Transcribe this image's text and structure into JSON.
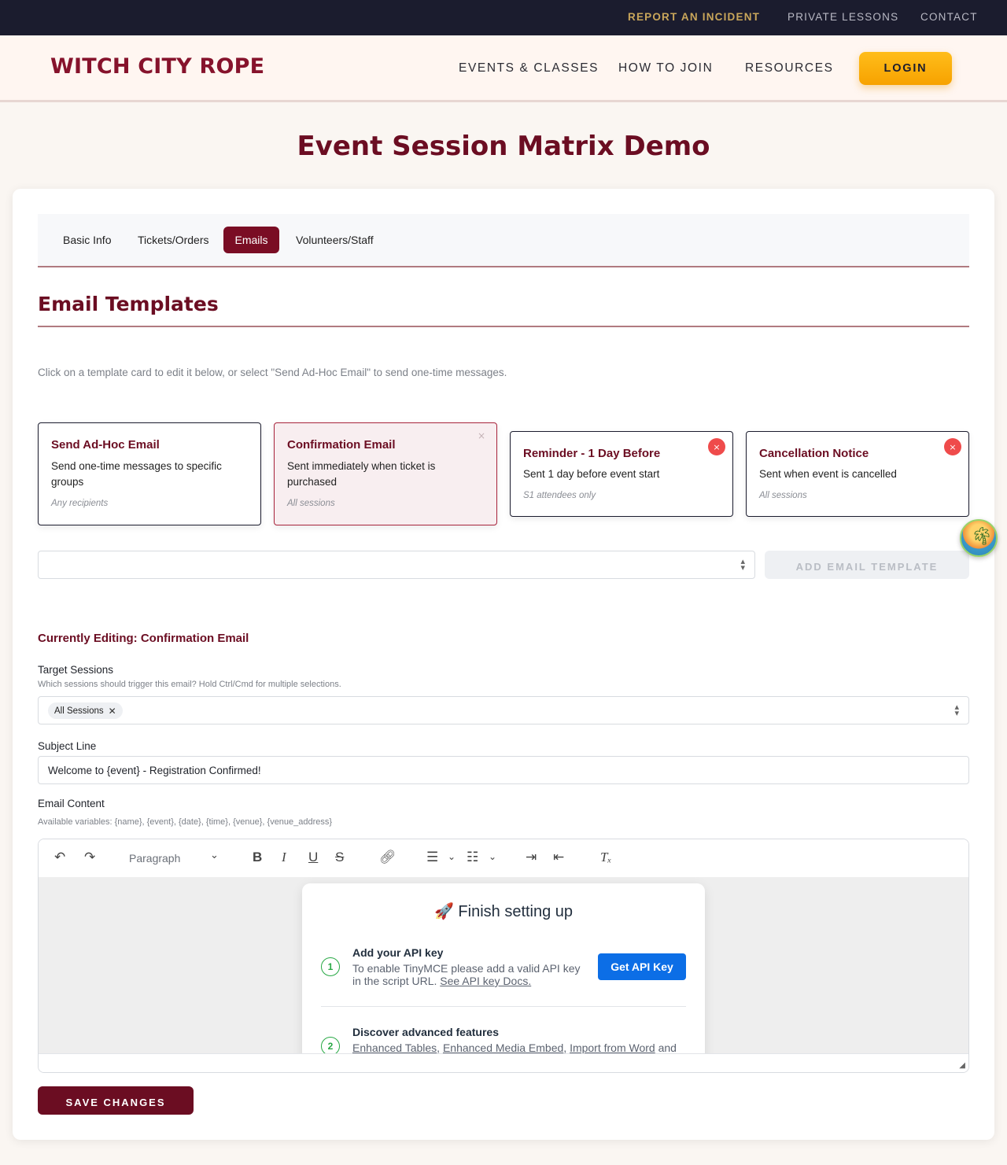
{
  "utility_nav": {
    "report": "REPORT AN INCIDENT",
    "lessons": "PRIVATE LESSONS",
    "contact": "CONTACT"
  },
  "header": {
    "logo": "WITCH CITY ROPE",
    "nav": {
      "events": "EVENTS & CLASSES",
      "join": "HOW TO JOIN",
      "resources": "RESOURCES"
    },
    "login": "LOGIN"
  },
  "page": {
    "title": "Event Session Matrix Demo"
  },
  "tabs": {
    "basic": "Basic Info",
    "tickets": "Tickets/Orders",
    "emails": "Emails",
    "volunteers": "Volunteers/Staff",
    "active": "Emails"
  },
  "email_templates": {
    "title": "Email Templates",
    "help": "Click on a template card to edit it below, or select \"Send Ad-Hoc Email\" to send one-time messages.",
    "cards": [
      {
        "title": "Send Ad-Hoc Email",
        "description": "Send one-time messages to specific groups",
        "meta": "Any recipients"
      },
      {
        "title": "Confirmation Email",
        "description": "Sent immediately when ticket is purchased",
        "meta": "All sessions",
        "close": "×"
      },
      {
        "title": "Reminder - 1 Day Before",
        "description": "Sent 1 day before event start",
        "meta": "S1 attendees only",
        "delete": "×"
      },
      {
        "title": "Cancellation Notice",
        "description": "Sent when event is cancelled",
        "meta": "All sessions",
        "delete": "×"
      }
    ],
    "template_select_value": "",
    "add_button": "ADD EMAIL TEMPLATE"
  },
  "editing": {
    "title": "Currently Editing: Confirmation Email",
    "target_label": "Target Sessions",
    "target_help": "Which sessions should trigger this email? Hold Ctrl/Cmd for multiple selections.",
    "target_chip": "All Sessions",
    "subject_label": "Subject Line",
    "subject_value": "Welcome to {event} - Registration Confirmed!",
    "content_label": "Email Content",
    "content_help": "Available variables: {name}, {event}, {date}, {time}, {venue}, {venue_address}"
  },
  "editor": {
    "paragraph": "Paragraph"
  },
  "setup_popup": {
    "title": "🚀 Finish setting up",
    "step1_number": "1",
    "step1_title": "Add your API key",
    "step1_text": "To enable TinyMCE please add a valid API key in the script URL.",
    "step1_link": "See API key Docs.",
    "api_button": "Get API Key",
    "step2_number": "2",
    "step2_title": "Discover advanced features",
    "step2_links": [
      "Enhanced Tables",
      "Enhanced Media Embed",
      "Import from Word"
    ],
    "step2_tail": "and"
  },
  "save_button": "SAVE CHANGES",
  "colors": {
    "brand": "#86132c",
    "brand_dark": "#6b0d22",
    "login": "#ffb000",
    "utility_bar": "#1b1c2e",
    "incident": "#c9a65a",
    "api_button": "#0c6ee6",
    "delete": "#ef4b4b"
  },
  "icons": [
    "undo-icon",
    "redo-icon",
    "bold-icon",
    "italic-icon",
    "underline-icon",
    "strikethrough-icon",
    "link-icon",
    "bullet-list-icon",
    "numbered-list-icon",
    "indent-icon",
    "outdent-icon",
    "clear-format-icon",
    "chevron-down-icon",
    "palm-avatar-icon"
  ]
}
